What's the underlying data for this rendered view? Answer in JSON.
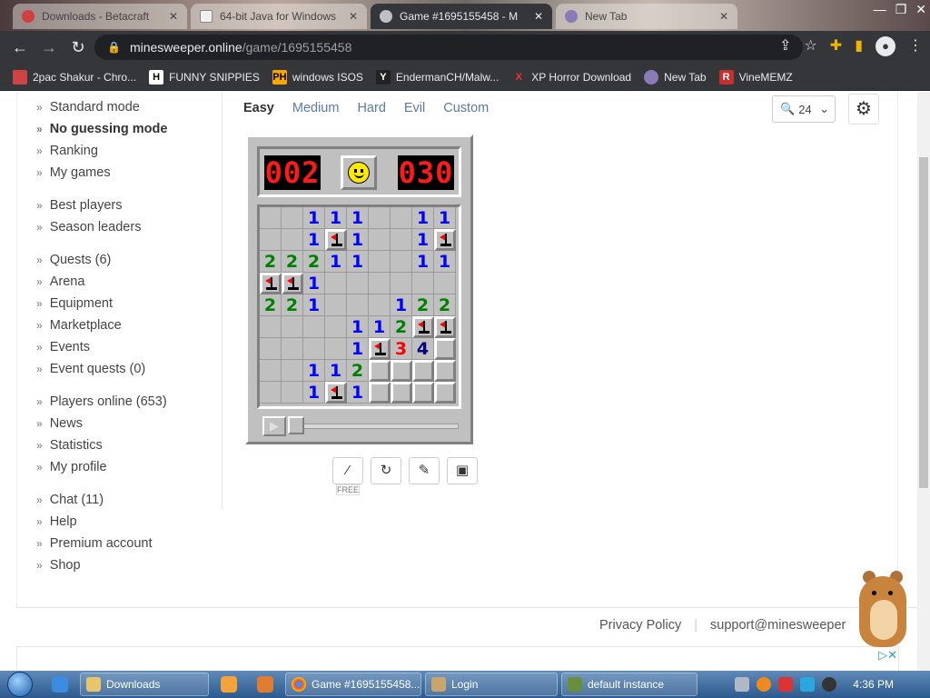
{
  "browser": {
    "tabs": [
      {
        "label": "Downloads - Betacraft",
        "active": false
      },
      {
        "label": "64-bit Java for Windows",
        "active": false
      },
      {
        "label": "Game #1695155458 - M",
        "active": true
      },
      {
        "label": "New Tab",
        "active": false
      }
    ],
    "url_host": "minesweeper.online",
    "url_path": "/game/1695155458",
    "bookmarks": [
      {
        "label": "2pac Shakur - Chro..."
      },
      {
        "label": "FUNNY SNIPPIES"
      },
      {
        "label": "windows ISOS"
      },
      {
        "label": "EndermanCH/Malw..."
      },
      {
        "label": "XP Horror Download"
      },
      {
        "label": "New Tab"
      },
      {
        "label": "VineMEMZ"
      }
    ]
  },
  "sidebar": {
    "items": [
      {
        "label": "Standard mode"
      },
      {
        "label": "No guessing mode"
      },
      {
        "label": "Ranking"
      },
      {
        "label": "My games"
      },
      {
        "label": "Best players"
      },
      {
        "label": "Season leaders"
      },
      {
        "label": "Quests (6)"
      },
      {
        "label": "Arena"
      },
      {
        "label": "Equipment"
      },
      {
        "label": "Marketplace"
      },
      {
        "label": "Events"
      },
      {
        "label": "Event quests (0)"
      },
      {
        "label": "Players online (653)"
      },
      {
        "label": "News"
      },
      {
        "label": "Statistics"
      },
      {
        "label": "My profile"
      },
      {
        "label": "Chat (11)"
      },
      {
        "label": "Help"
      },
      {
        "label": "Premium account"
      },
      {
        "label": "Shop"
      }
    ]
  },
  "modes": [
    "Easy",
    "Medium",
    "Hard",
    "Evil",
    "Custom"
  ],
  "selected_mode": "Easy",
  "zoom": "24",
  "game": {
    "mines_left": "002",
    "timer": "030",
    "rows": [
      [
        "o",
        "o",
        "1",
        "1",
        "1",
        "o",
        "o",
        "1",
        "1"
      ],
      [
        "o",
        "o",
        "1",
        "F",
        "1",
        "o",
        "o",
        "1",
        "F"
      ],
      [
        "2",
        "2",
        "2",
        "1",
        "1",
        "o",
        "o",
        "1",
        "1"
      ],
      [
        "F",
        "F",
        "1",
        "o",
        "o",
        "o",
        "o",
        "o",
        "o"
      ],
      [
        "2",
        "2",
        "1",
        "o",
        "o",
        "o",
        "1",
        "2",
        "2"
      ],
      [
        "o",
        "o",
        "o",
        "o",
        "1",
        "1",
        "2",
        "F",
        "F"
      ],
      [
        "o",
        "o",
        "o",
        "o",
        "1",
        "F",
        "3",
        "4",
        "C"
      ],
      [
        "o",
        "o",
        "1",
        "1",
        "2",
        "C",
        "C",
        "C",
        "C"
      ],
      [
        "o",
        "o",
        "1",
        "F",
        "1",
        "C",
        "C",
        "C",
        "C"
      ]
    ]
  },
  "actions": {
    "free_label": "FREE"
  },
  "footer": {
    "privacy": "Privacy Policy",
    "support": "support@minesweeper"
  },
  "taskbar": {
    "items": [
      {
        "label": "Downloads"
      },
      {
        "label": "Game #1695155458..."
      },
      {
        "label": "Login"
      },
      {
        "label": "default instance"
      }
    ],
    "clock": "4:36 PM"
  }
}
